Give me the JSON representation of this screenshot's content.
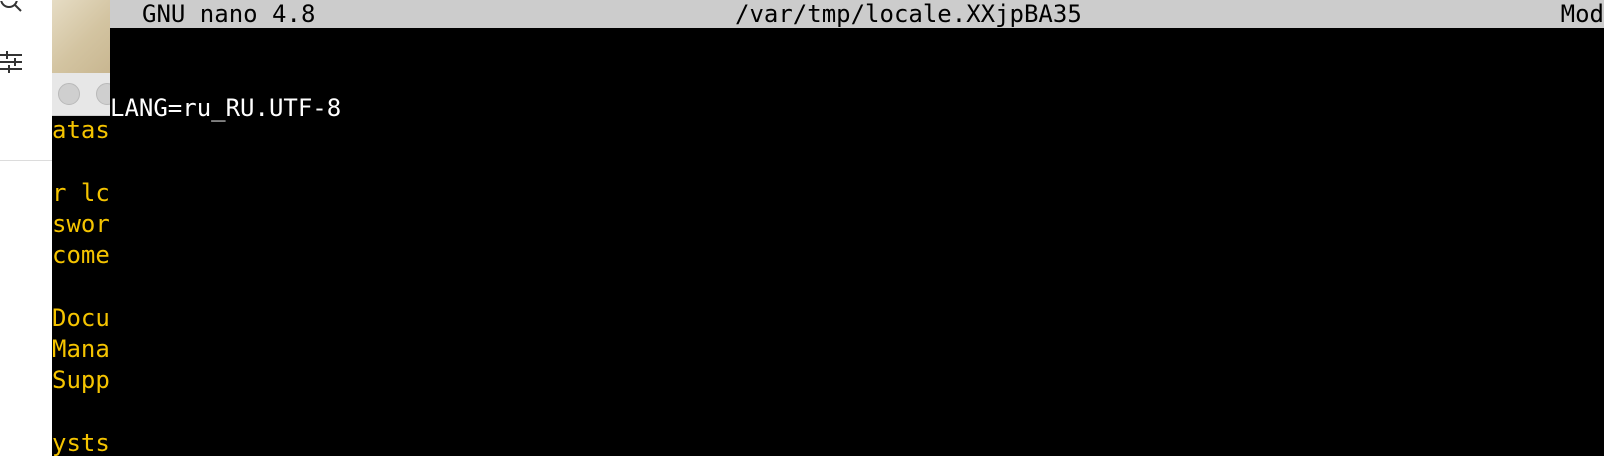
{
  "nano": {
    "title_bar": {
      "version": "GNU nano 4.8",
      "filename": "/var/tmp/locale.XXjpBA35",
      "status": "Mod"
    },
    "content_lines": [
      "LANG=ru_RU.UTF-8"
    ]
  },
  "background_terminal": {
    "visible_line_fragments": [
      "atas",
      "",
      "r lc",
      "swor",
      "come",
      "",
      "Docu",
      "Mana",
      "Supp",
      "",
      "ysts"
    ],
    "text_color": "#f5c400"
  },
  "colors": {
    "nano_titlebar_bg": "#cccccc",
    "terminal_bg": "#000000",
    "sidebar_bg": "#ffffff"
  }
}
